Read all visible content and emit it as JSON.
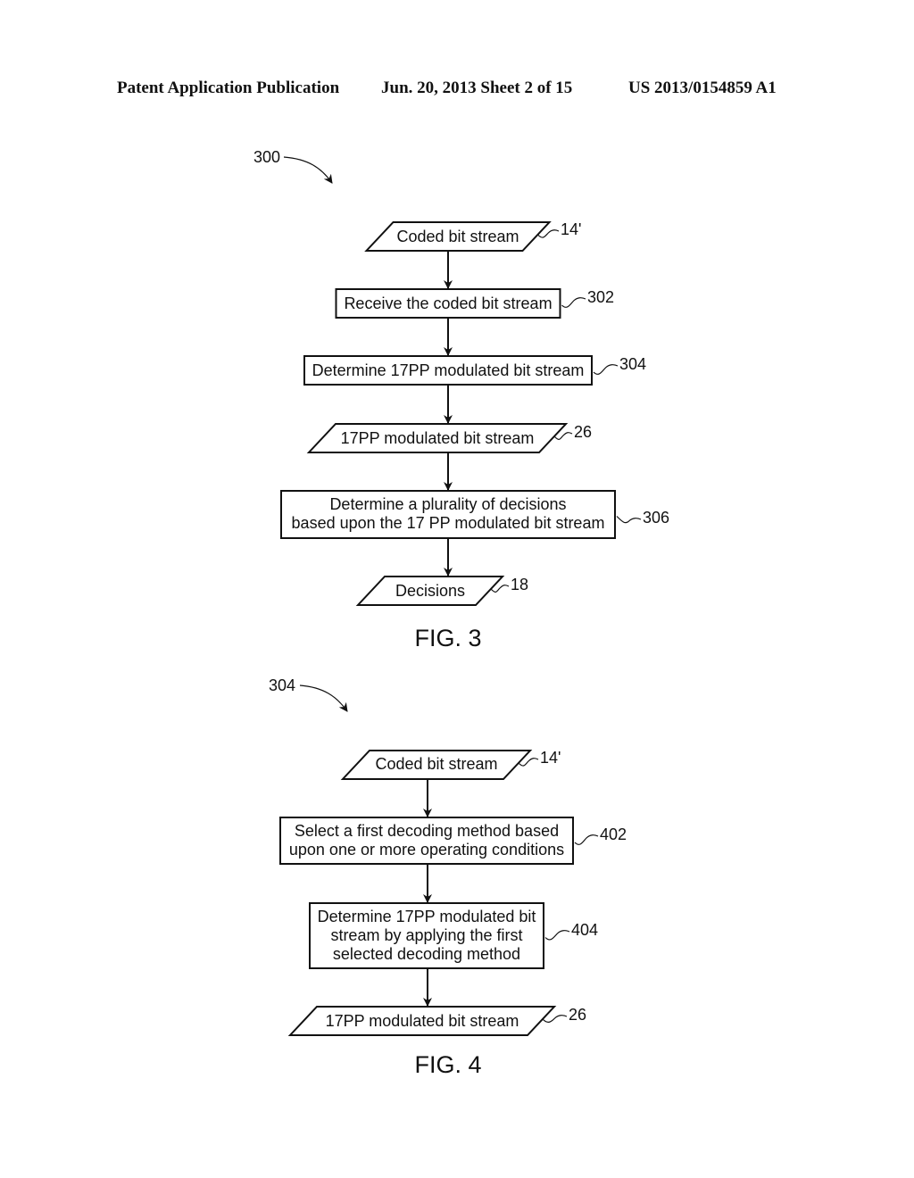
{
  "header": {
    "publication": "Patent Application Publication",
    "date_sheet": "Jun. 20, 2013  Sheet 2 of 15",
    "number": "US 2013/0154859 A1"
  },
  "figures": [
    {
      "id": "fig3",
      "caption": "FIG. 3",
      "ref_label": "300",
      "nodes": [
        {
          "type": "io",
          "lines": [
            "Coded bit stream"
          ],
          "ref": "14'"
        },
        {
          "type": "process",
          "lines": [
            "Receive the coded bit stream"
          ],
          "ref": "302"
        },
        {
          "type": "process",
          "lines": [
            "Determine 17PP modulated bit stream"
          ],
          "ref": "304"
        },
        {
          "type": "io",
          "lines": [
            "17PP modulated bit stream"
          ],
          "ref": "26"
        },
        {
          "type": "process",
          "lines": [
            "Determine a plurality of decisions",
            "based upon the 17 PP modulated bit stream"
          ],
          "ref": "306"
        },
        {
          "type": "io",
          "lines": [
            "Decisions"
          ],
          "ref": "18"
        }
      ]
    },
    {
      "id": "fig4",
      "caption": "FIG. 4",
      "ref_label": "304",
      "nodes": [
        {
          "type": "io",
          "lines": [
            "Coded bit stream"
          ],
          "ref": "14'"
        },
        {
          "type": "process",
          "lines": [
            "Select a first decoding method based",
            "upon one or more operating conditions"
          ],
          "ref": "402"
        },
        {
          "type": "process",
          "lines": [
            "Determine 17PP modulated bit",
            "stream by applying the first",
            "selected decoding method"
          ],
          "ref": "404"
        },
        {
          "type": "io",
          "lines": [
            "17PP modulated bit stream"
          ],
          "ref": "26"
        }
      ]
    }
  ]
}
